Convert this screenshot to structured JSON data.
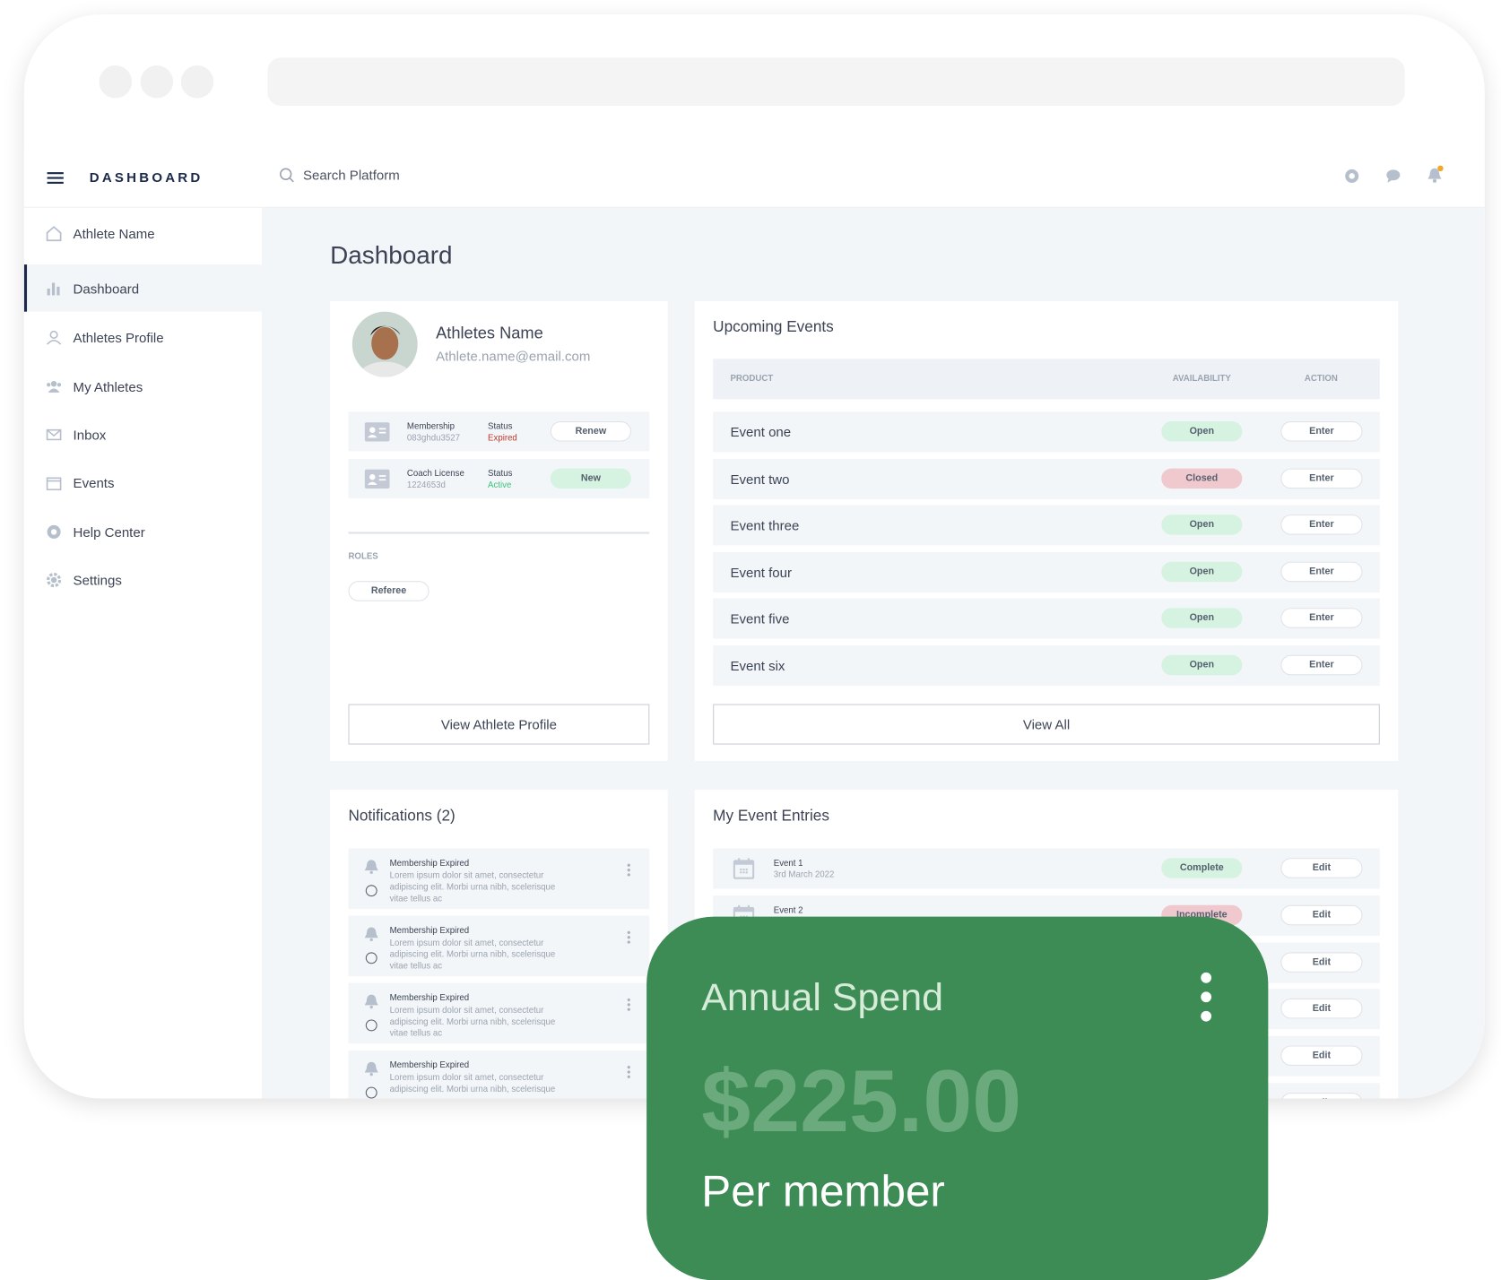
{
  "brand": "DASHBOARD",
  "search": {
    "placeholder": "Search Platform"
  },
  "topbar_icons": [
    "globe-icon",
    "chat-icon",
    "bell-icon"
  ],
  "sidebar": {
    "items": [
      {
        "label": "Athlete Name",
        "icon": "home-icon"
      },
      {
        "label": "Dashboard",
        "icon": "bar-chart-icon",
        "active": true
      },
      {
        "label": "Athletes Profile",
        "icon": "user-icon"
      },
      {
        "label": "My Athletes",
        "icon": "users-icon"
      },
      {
        "label": "Inbox",
        "icon": "mail-icon"
      },
      {
        "label": "Events",
        "icon": "calendar-icon"
      },
      {
        "label": "Help Center",
        "icon": "lifebuoy-icon"
      },
      {
        "label": "Settings",
        "icon": "gear-icon"
      }
    ]
  },
  "page_title": "Dashboard",
  "profile": {
    "name": "Athletes Name",
    "email": "Athlete.name@email.com",
    "licenses": [
      {
        "title": "Membership",
        "id": "083ghdu3527",
        "status_label": "Status",
        "status": "Expired",
        "action": "Renew"
      },
      {
        "title": "Coach License",
        "id": "1224653d",
        "status_label": "Status",
        "status": "Active",
        "action": "New"
      }
    ],
    "roles_label": "ROLES",
    "roles": [
      "Referee"
    ],
    "view_button": "View Athlete Profile"
  },
  "events": {
    "title": "Upcoming Events",
    "columns": [
      "PRODUCT",
      "AVAILABILITY",
      "ACTION"
    ],
    "rows": [
      {
        "name": "Event one",
        "availability": "Open",
        "action": "Enter"
      },
      {
        "name": "Event two",
        "availability": "Closed",
        "action": "Enter"
      },
      {
        "name": "Event three",
        "availability": "Open",
        "action": "Enter"
      },
      {
        "name": "Event four",
        "availability": "Open",
        "action": "Enter"
      },
      {
        "name": "Event five",
        "availability": "Open",
        "action": "Enter"
      },
      {
        "name": "Event six",
        "availability": "Open",
        "action": "Enter"
      }
    ],
    "view_all": "View All"
  },
  "notifications": {
    "title": "Notifications (2)",
    "items": [
      {
        "title": "Membership Expired",
        "body": "Lorem ipsum dolor sit amet, consectetur adipiscing elit. Morbi urna nibh, scelerisque vitae tellus ac"
      },
      {
        "title": "Membership Expired",
        "body": "Lorem ipsum dolor sit amet, consectetur adipiscing elit. Morbi urna nibh, scelerisque vitae tellus ac"
      },
      {
        "title": "Membership Expired",
        "body": "Lorem ipsum dolor sit amet, consectetur adipiscing elit. Morbi urna nibh, scelerisque vitae tellus ac"
      },
      {
        "title": "Membership Expired",
        "body": "Lorem ipsum dolor sit amet, consectetur adipiscing elit. Morbi urna nibh, scelerisque"
      }
    ]
  },
  "entries": {
    "title": "My Event Entries",
    "rows": [
      {
        "name": "Event 1",
        "date": "3rd March 2022",
        "status": "Complete",
        "action": "Edit"
      },
      {
        "name": "Event 2",
        "status": "Incomplete",
        "action": "Edit"
      },
      {
        "action": "Edit"
      },
      {
        "action": "Edit"
      },
      {
        "action": "Edit"
      },
      {
        "action": "Edit"
      }
    ]
  },
  "spend": {
    "title": "Annual Spend",
    "amount": "$225.00",
    "subtitle": "Per member"
  },
  "colors": {
    "accent": "#1b2a4a",
    "spend_card": "#3d8c55",
    "open": "#d6f3e2",
    "closed": "#f0c9cf",
    "expired": "#c0392b",
    "active": "#3cc47c",
    "notification_dot": "#f5a623"
  }
}
